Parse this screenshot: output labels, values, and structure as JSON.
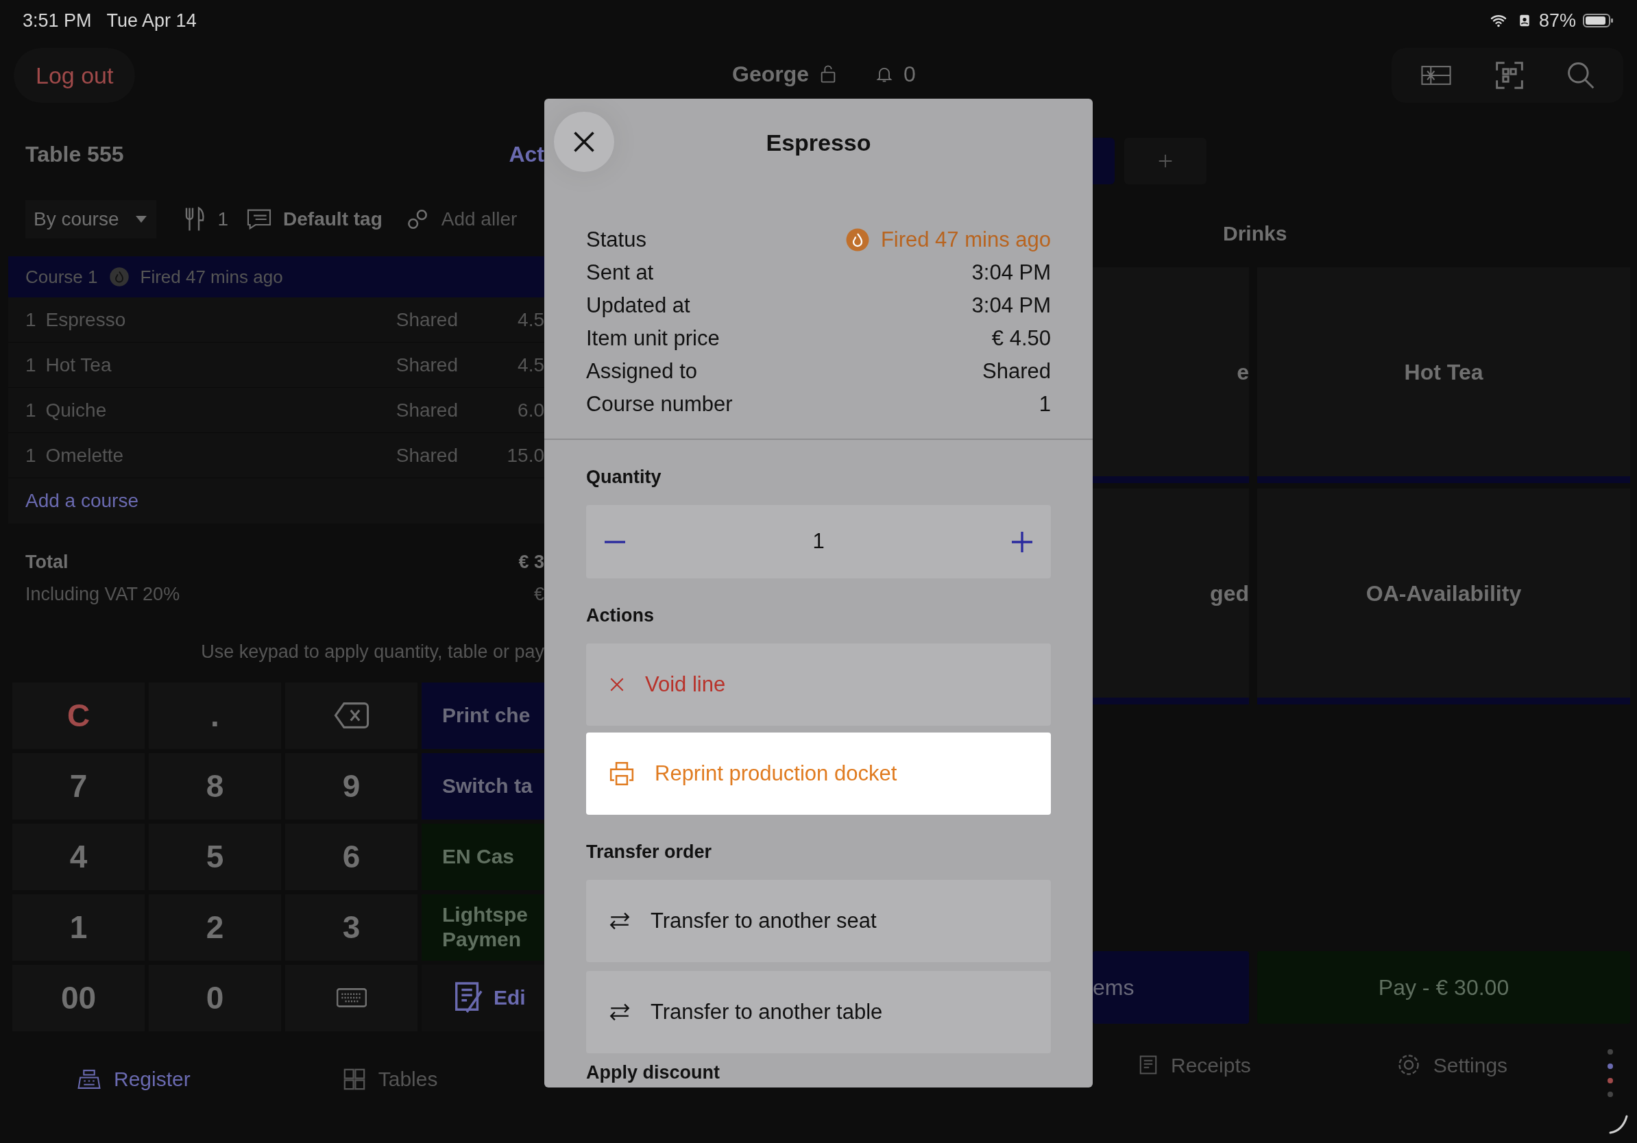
{
  "status_bar": {
    "time": "3:51 PM",
    "date": "Tue Apr 14",
    "battery": "87%"
  },
  "header": {
    "logout": "Log out",
    "user": "George",
    "notifications": "0"
  },
  "order": {
    "title": "Table 555",
    "actions_cut": "Act",
    "toolbar": {
      "grouping": "By course",
      "guests": "1",
      "tag": "Default tag",
      "allergens": "Add aller"
    },
    "course": {
      "label": "Course 1",
      "status": "Fired 47 mins ago"
    },
    "lines": [
      {
        "qty": "1",
        "name": "Espresso",
        "assigned": "Shared",
        "price": "4.5"
      },
      {
        "qty": "1",
        "name": "Hot Tea",
        "assigned": "Shared",
        "price": "4.5"
      },
      {
        "qty": "1",
        "name": "Quiche",
        "assigned": "Shared",
        "price": "6.0"
      },
      {
        "qty": "1",
        "name": "Omelette",
        "assigned": "Shared",
        "price": "15.0"
      }
    ],
    "add_course": "Add a course",
    "total_label": "Total",
    "total_value": "€ 3",
    "vat_label": "Including VAT 20%",
    "vat_value": "€",
    "hint": "Use keypad to apply quantity, table or pay"
  },
  "keypad": [
    {
      "kind": "clear",
      "label": "C"
    },
    {
      "kind": "digit",
      "label": "."
    },
    {
      "kind": "backspace"
    },
    {
      "kind": "digit",
      "label": "7"
    },
    {
      "kind": "digit",
      "label": "8"
    },
    {
      "kind": "digit",
      "label": "9"
    },
    {
      "kind": "digit",
      "label": "4"
    },
    {
      "kind": "digit",
      "label": "5"
    },
    {
      "kind": "digit",
      "label": "6"
    },
    {
      "kind": "digit",
      "label": "1"
    },
    {
      "kind": "digit",
      "label": "2"
    },
    {
      "kind": "digit",
      "label": "3"
    },
    {
      "kind": "digit",
      "label": "00"
    },
    {
      "kind": "digit",
      "label": "0"
    },
    {
      "kind": "keyboard"
    }
  ],
  "side_buttons": [
    {
      "kind": "primary",
      "label": "Print che"
    },
    {
      "kind": "primary",
      "label": "Switch ta"
    },
    {
      "kind": "payment",
      "label": "EN Cas"
    },
    {
      "kind": "payment",
      "label": "Lightspe\nPaymen"
    },
    {
      "kind": "edit",
      "label": "Edi"
    }
  ],
  "products": {
    "section": "Drinks",
    "tiles": [
      {
        "label": "e"
      },
      {
        "label": "Hot Tea"
      },
      {
        "label": "ged"
      },
      {
        "label": "OA-Availability"
      }
    ],
    "bottom_buttons": [
      {
        "kind": "primary",
        "label": "ems"
      },
      {
        "kind": "pay",
        "label": "Pay - € 30.00"
      }
    ]
  },
  "nav": [
    {
      "label": "Register",
      "selected": true
    },
    {
      "label": "Tables",
      "selected": false
    },
    {
      "label": "Receipts",
      "selected": false
    },
    {
      "label": "Settings",
      "selected": false
    }
  ],
  "modal": {
    "title": "Espresso",
    "details": [
      {
        "label": "Status",
        "value": "Fired 47 mins ago",
        "kind": "status"
      },
      {
        "label": "Sent at",
        "value": "3:04 PM",
        "kind": "text"
      },
      {
        "label": "Updated at",
        "value": "3:04 PM",
        "kind": "text"
      },
      {
        "label": "Item unit price",
        "value": "€ 4.50",
        "kind": "text"
      },
      {
        "label": "Assigned to",
        "value": "Shared",
        "kind": "text"
      },
      {
        "label": "Course number",
        "value": "1",
        "kind": "text"
      }
    ],
    "quantity": {
      "label": "Quantity",
      "value": "1"
    },
    "actions": {
      "label": "Actions",
      "items": [
        {
          "label": "Void line",
          "kind": "void",
          "highlighted": false
        },
        {
          "label": "Reprint production docket",
          "kind": "reprint",
          "highlighted": true
        }
      ]
    },
    "transfer": {
      "label": "Transfer order",
      "items": [
        {
          "label": "Transfer to another seat",
          "highlighted": false
        },
        {
          "label": "Transfer to another table",
          "highlighted": false
        }
      ]
    },
    "next_section": "Apply discount"
  }
}
